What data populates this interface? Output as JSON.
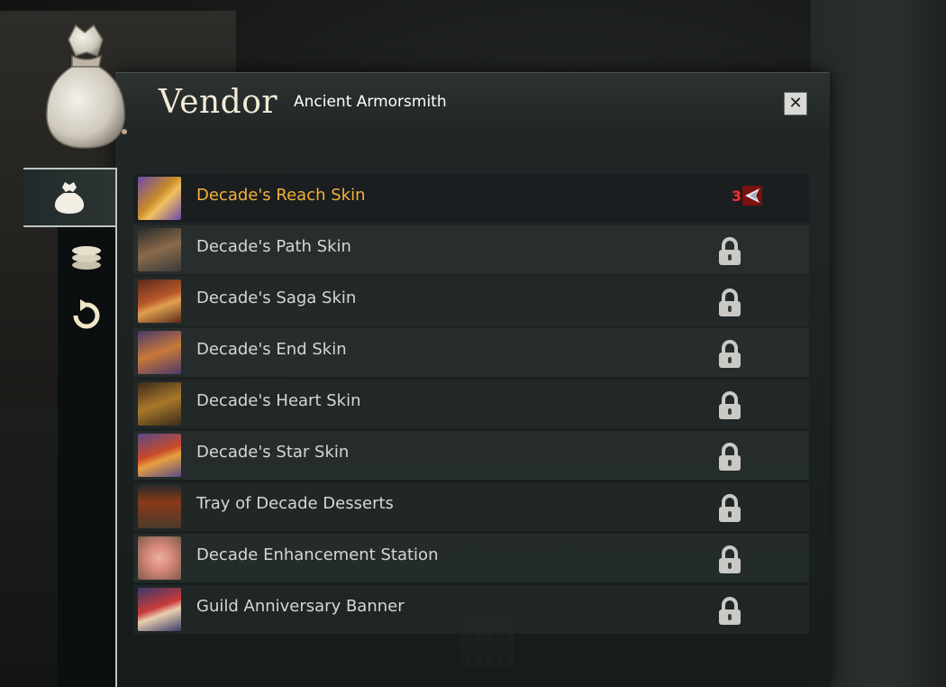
{
  "window": {
    "title": "Vendor",
    "subtitle": "Ancient Armorsmith",
    "close_label": "✕"
  },
  "tabs": [
    {
      "name": "tab-buy",
      "icon": "bag-icon",
      "active": true
    },
    {
      "name": "tab-sell",
      "icon": "coins-icon",
      "active": false
    },
    {
      "name": "tab-buyback",
      "icon": "buyback-icon",
      "active": false
    }
  ],
  "items": [
    {
      "label": "Decade's Reach Skin",
      "selected": true,
      "locked": false,
      "price": "3",
      "currency_icon": "currency-icon",
      "thumb_colors": [
        "#c88a2a",
        "#6a4aa8"
      ]
    },
    {
      "label": "Decade's Path Skin",
      "selected": false,
      "locked": true,
      "thumb_colors": [
        "#8a6a4a",
        "#3a3a3a"
      ]
    },
    {
      "label": "Decade's Saga Skin",
      "selected": false,
      "locked": true,
      "thumb_colors": [
        "#b8582a",
        "#5a2a1a"
      ]
    },
    {
      "label": "Decade's End Skin",
      "selected": false,
      "locked": true,
      "thumb_colors": [
        "#c8783a",
        "#4a3a6a"
      ]
    },
    {
      "label": "Decade's Heart Skin",
      "selected": false,
      "locked": true,
      "thumb_colors": [
        "#a8782a",
        "#3a2a1a"
      ]
    },
    {
      "label": "Decade's Star Skin",
      "selected": false,
      "locked": true,
      "thumb_colors": [
        "#c84a2a",
        "#5a4a8a"
      ]
    },
    {
      "label": "Tray of Decade Desserts",
      "selected": false,
      "locked": true,
      "thumb_colors": [
        "#8a3a1a",
        "#4a3a2a"
      ]
    },
    {
      "label": "Decade Enhancement Station",
      "selected": false,
      "locked": true,
      "thumb_colors": [
        "#d88a7a",
        "#7a5a4a"
      ]
    },
    {
      "label": "Guild Anniversary Banner",
      "selected": false,
      "locked": true,
      "thumb_colors": [
        "#c83a3a",
        "#3a3a6a"
      ]
    }
  ],
  "colors": {
    "selected_text": "#f4b13a",
    "item_text": "#d8d6d0",
    "price_text": "#ff2a2a"
  }
}
